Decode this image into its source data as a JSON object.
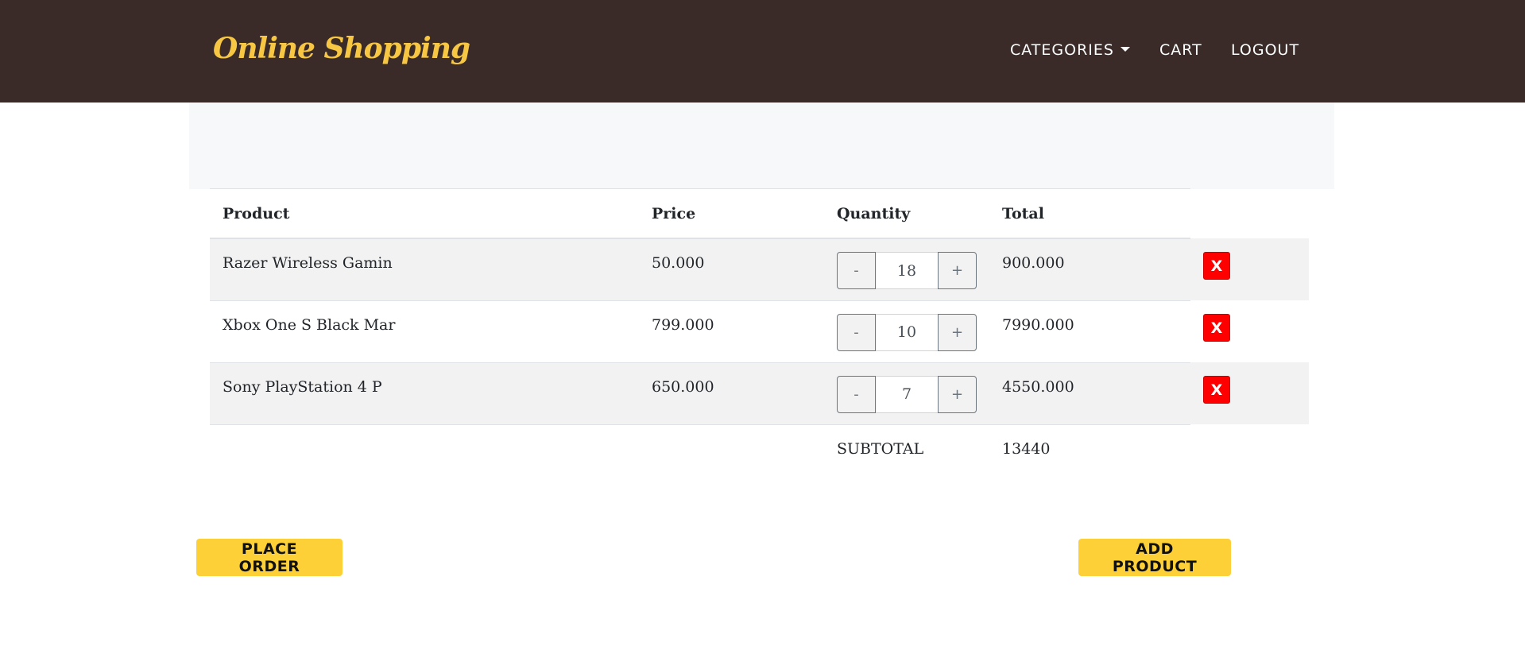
{
  "navbar": {
    "brand": "Online Shopping",
    "items": [
      {
        "label": "CATEGORIES"
      },
      {
        "label": "CART"
      },
      {
        "label": "LOGOUT"
      }
    ]
  },
  "table": {
    "headers": {
      "product": "Product",
      "price": "Price",
      "quantity": "Quantity",
      "total": "Total"
    },
    "rows": [
      {
        "product": "Razer Wireless Gamin",
        "price": "50.000",
        "quantity": "18",
        "total": "900.000",
        "minus": "-",
        "plus": "+",
        "delete": "X"
      },
      {
        "product": "Xbox One S Black Mar",
        "price": "799.000",
        "quantity": "10",
        "total": "7990.000",
        "minus": "-",
        "plus": "+",
        "delete": "X"
      },
      {
        "product": "Sony PlayStation 4 P",
        "price": "650.000",
        "quantity": "7",
        "total": "4550.000",
        "minus": "-",
        "plus": "+",
        "delete": "X"
      }
    ],
    "subtotal_label": "SUBTOTAL",
    "subtotal_value": "13440"
  },
  "actions": {
    "place_order": "PLACE ORDER",
    "add_product": "ADD PRODUCT"
  },
  "colors": {
    "navbar_bg": "#3a2b28",
    "brand": "#f7c744",
    "accent_button": "#fdd037",
    "delete_button": "#ff0000"
  }
}
